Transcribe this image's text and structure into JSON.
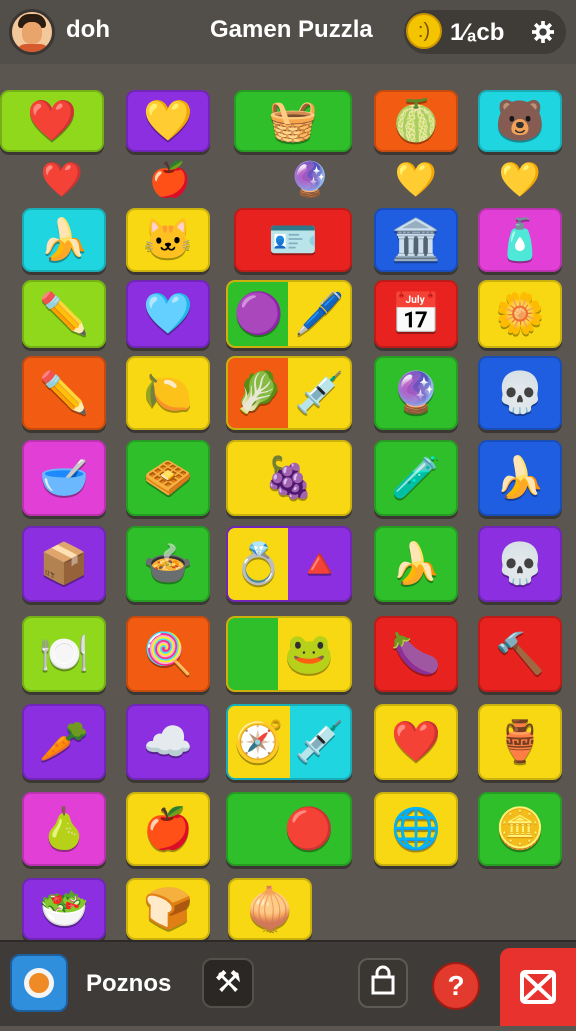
{
  "header": {
    "username": "doh",
    "title": "Gamen Puzzla",
    "coins": "1⁄ₐcb",
    "coin_icon": "coin-face-icon",
    "settings_icon": "gear-icon"
  },
  "palette": {
    "background": "#5b5650",
    "lime": "#8fd81c",
    "purple": "#8b2fe0",
    "green": "#2fbf2a",
    "orange": "#f25c12",
    "cyan": "#1fd5e0",
    "yellow": "#f7d812",
    "red": "#e8231f",
    "blue": "#1f5ee0",
    "magenta": "#e23fd6"
  },
  "bottom_bar": {
    "label": "Poznos",
    "home_icon": "home-ring-icon",
    "tools_icon": "tools-icon",
    "bag_icon": "bag-icon",
    "help_icon": "help-icon",
    "help_label": "?",
    "close_icon": "close-icon"
  }
}
